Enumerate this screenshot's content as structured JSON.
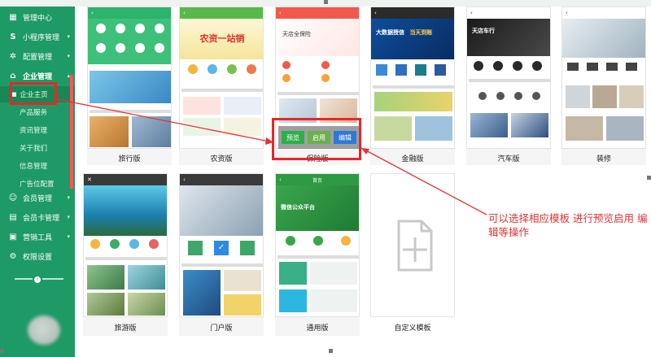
{
  "sidebar": {
    "items": [
      {
        "label": "管理中心",
        "icon": "dashboard-icon"
      },
      {
        "label": "小程序管理",
        "icon": "s-logo-icon"
      },
      {
        "label": "配置管理",
        "icon": "gear-cluster-icon"
      },
      {
        "label": "企业管理",
        "icon": "building-icon"
      },
      {
        "label": "会员管理",
        "icon": "user-icon"
      },
      {
        "label": "会员卡管理",
        "icon": "card-icon"
      },
      {
        "label": "营销工具",
        "icon": "briefcase-icon"
      },
      {
        "label": "权限设置",
        "icon": "gear-icon"
      }
    ],
    "sub_items": [
      {
        "label": "企业主页"
      },
      {
        "label": "产品服务"
      },
      {
        "label": "资讯管理"
      },
      {
        "label": "关于我们"
      },
      {
        "label": "信息管理"
      },
      {
        "label": "广告位配置"
      }
    ]
  },
  "templates": [
    {
      "label": "旅行版",
      "color": "#2db36c"
    },
    {
      "label": "农资版",
      "color": "#58b94a"
    },
    {
      "label": "保险版",
      "color": "#f2594c"
    },
    {
      "label": "金融版",
      "color": "#2b2b2b"
    },
    {
      "label": "汽车版",
      "color": "#ffffff"
    },
    {
      "label": "装修",
      "color": "#ffffff"
    },
    {
      "label": "旅游版",
      "color": "#3dab6a"
    },
    {
      "label": "门户版",
      "color": "#3b3b3b"
    },
    {
      "label": "通用版",
      "color": "#2e9a43"
    },
    {
      "label": "自定义模板",
      "color": "#ffffff"
    }
  ],
  "overlay_buttons": {
    "preview": "预览",
    "enable": "启用",
    "edit": "编辑"
  },
  "annotation": "可以选择相应模板 进行预览启用 编辑等操作",
  "phone_text": {
    "agri_banner": "农资一站销",
    "insure_title": "天店全保险",
    "finance_banner1": "大数据授信",
    "finance_banner2": "当天到账",
    "car_brand": "天店车行",
    "general_brand": "微信公众平台",
    "general_title": "首页"
  }
}
